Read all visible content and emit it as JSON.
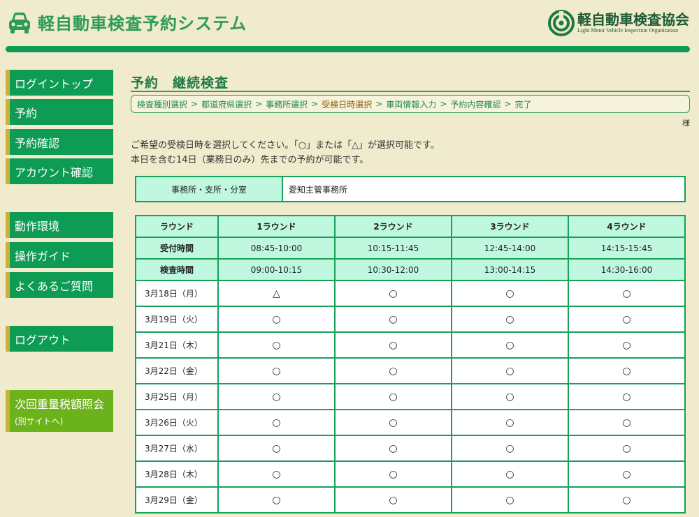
{
  "header": {
    "system_title": "軽自動車検査予約システム",
    "org_name": "軽自動車検査協会",
    "org_name_en": "Light Motor Vehicle Inspection Organization"
  },
  "colors": {
    "accent": "#0e9b54",
    "accent_light": "#6cb21a",
    "table_header": "#bff8df",
    "background": "#efebcc"
  },
  "sidebar": {
    "items": [
      {
        "label": "ログイントップ"
      },
      {
        "label": "予約"
      },
      {
        "label": "予約確認"
      },
      {
        "label": "アカウント確認"
      },
      {
        "label": "動作環境"
      },
      {
        "label": "操作ガイド"
      },
      {
        "label": "よくあるご質問"
      },
      {
        "label": "ログアウト"
      }
    ],
    "external": {
      "label": "次回重量税額照会",
      "sub": "(別サイトへ)"
    }
  },
  "main": {
    "title": "予約　継続検査",
    "breadcrumb": [
      "検査種別選択",
      "都道府県選択",
      "事務所選択",
      "受検日時選択",
      "車両情報入力",
      "予約内容確認",
      "完了"
    ],
    "breadcrumb_sep": ">",
    "user_suffix": "様",
    "instructions": [
      "ご希望の受検日時を選択してください。「○」または「△」が選択可能です。",
      "本日を含む14日（業務日のみ）先までの予約が可能です。"
    ],
    "office": {
      "label": "事務所・支所・分室",
      "value": "愛知主管事務所"
    }
  },
  "schedule": {
    "round_header": "ラウンド",
    "rounds": [
      "1ラウンド",
      "2ラウンド",
      "3ラウンド",
      "4ラウンド"
    ],
    "reception_label": "受付時間",
    "reception": [
      "08:45-10:00",
      "10:15-11:45",
      "12:45-14:00",
      "14:15-15:45"
    ],
    "inspection_label": "検査時間",
    "inspection": [
      "09:00-10:15",
      "10:30-12:00",
      "13:00-14:15",
      "14:30-16:00"
    ],
    "days": [
      {
        "date": "3月18日（月）",
        "slots": [
          "△",
          "○",
          "○",
          "○"
        ]
      },
      {
        "date": "3月19日（火）",
        "slots": [
          "○",
          "○",
          "○",
          "○"
        ]
      },
      {
        "date": "3月21日（木）",
        "slots": [
          "○",
          "○",
          "○",
          "○"
        ]
      },
      {
        "date": "3月22日（金）",
        "slots": [
          "○",
          "○",
          "○",
          "○"
        ]
      },
      {
        "date": "3月25日（月）",
        "slots": [
          "○",
          "○",
          "○",
          "○"
        ]
      },
      {
        "date": "3月26日（火）",
        "slots": [
          "○",
          "○",
          "○",
          "○"
        ]
      },
      {
        "date": "3月27日（水）",
        "slots": [
          "○",
          "○",
          "○",
          "○"
        ]
      },
      {
        "date": "3月28日（木）",
        "slots": [
          "○",
          "○",
          "○",
          "○"
        ]
      },
      {
        "date": "3月29日（金）",
        "slots": [
          "○",
          "○",
          "○",
          "○"
        ]
      }
    ]
  }
}
